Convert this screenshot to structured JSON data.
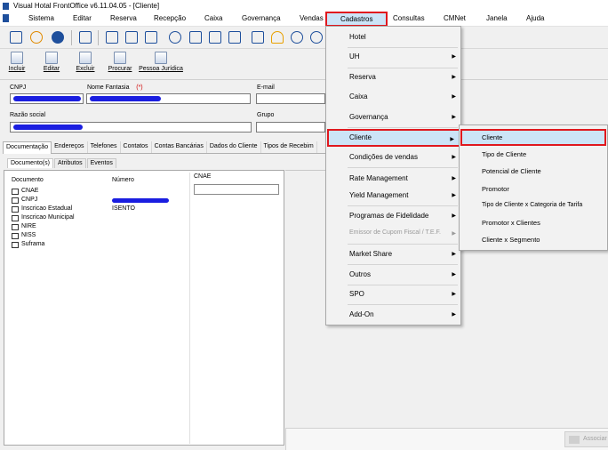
{
  "window": {
    "title": "Visual Hotal FrontOffice v6.11.04.05 - [Cliente]"
  },
  "menubar": {
    "items": [
      {
        "label": "Sistema"
      },
      {
        "label": "Editar"
      },
      {
        "label": "Reserva"
      },
      {
        "label": "Recepção"
      },
      {
        "label": "Caixa"
      },
      {
        "label": "Governança"
      },
      {
        "label": "Vendas"
      },
      {
        "label": "Cadastros",
        "active": true
      },
      {
        "label": "Consultas"
      },
      {
        "label": "CMNet"
      },
      {
        "label": "Janela"
      },
      {
        "label": "Ajuda"
      }
    ]
  },
  "toolbar": {
    "icons": [
      "door-exit-icon",
      "user-icon",
      "help-icon",
      "computer-icon",
      "mail-icon",
      "document-edit-icon",
      "mail-send-icon",
      "search-icon",
      "calendar-icon",
      "id-card-icon",
      "list-icon",
      "document-check-icon",
      "bell-icon",
      "users-icon",
      "person-icon"
    ]
  },
  "actions": {
    "incluir": "Incluir",
    "editar": "Editar",
    "excluir": "Excluir",
    "procurar": "Procurar",
    "pessoa_juridica": "Pessoa Jurídica"
  },
  "form": {
    "cnpj_label": "CNPJ",
    "nome_fantasia_label": "Nome Fantasia",
    "required_mark": "(*)",
    "email_label": "E-mail",
    "razao_social_label": "Razão social",
    "grupo_label": "Grupo"
  },
  "tabs": [
    {
      "label": "Documentação",
      "active": true
    },
    {
      "label": "Endereços"
    },
    {
      "label": "Telefones"
    },
    {
      "label": "Contatos"
    },
    {
      "label": "Contas Bancárias"
    },
    {
      "label": "Dados do Cliente"
    },
    {
      "label": "Tipos de Recebim"
    }
  ],
  "subtabs": [
    {
      "label": "Documento(s)",
      "active": true
    },
    {
      "label": "Atributos"
    },
    {
      "label": "Eventos"
    }
  ],
  "documents": {
    "col_documento": "Documento",
    "col_numero": "Número",
    "col_cnae": "CNAE",
    "items": [
      {
        "name": "CNAE",
        "number": ""
      },
      {
        "name": "CNPJ",
        "number": ""
      },
      {
        "name": "Inscricao Estadual",
        "number": "ISENTO"
      },
      {
        "name": "Inscricao Municipal",
        "number": ""
      },
      {
        "name": "NIRE",
        "number": ""
      },
      {
        "name": "NISS",
        "number": ""
      },
      {
        "name": "Suframa",
        "number": ""
      }
    ]
  },
  "status": {
    "associar_label": "Associar"
  },
  "cadastros_menu": {
    "items": [
      {
        "label": "Hotel",
        "submenu": false
      },
      {
        "label": "UH",
        "submenu": true
      },
      {
        "label": "Reserva",
        "submenu": true
      },
      {
        "label": "Caixa",
        "submenu": true
      },
      {
        "label": "Governança",
        "submenu": true
      },
      {
        "label": "Cliente",
        "submenu": true,
        "active": true
      },
      {
        "label": "Condições de vendas",
        "submenu": true
      },
      {
        "label": "Rate Management",
        "submenu": true
      },
      {
        "label": "Yield Management",
        "submenu": true
      },
      {
        "label": "Programas de Fidelidade",
        "submenu": true
      },
      {
        "label": "Emissor de Cupom Fiscal / T.E.F.",
        "submenu": true,
        "disabled": true
      },
      {
        "label": "Market Share",
        "submenu": true
      },
      {
        "label": "Outros",
        "submenu": true
      },
      {
        "label": "SPO",
        "submenu": true
      },
      {
        "label": "Add-On",
        "submenu": true
      }
    ]
  },
  "cliente_submenu": {
    "items": [
      {
        "label": "Cliente",
        "active": true
      },
      {
        "label": "Tipo de Cliente"
      },
      {
        "label": "Potencial de Cliente"
      },
      {
        "label": "Promotor"
      },
      {
        "label": "Tipo de Cliente x Categoria de Tarifa"
      },
      {
        "label": "Promotor x Clientes"
      },
      {
        "label": "Cliente x Segmento"
      }
    ]
  },
  "colors": {
    "accent_highlight": "#cce4f7",
    "annotation_red": "#e0181e",
    "redaction_blue": "#1a1ee0",
    "brand_blue": "#1e4f9c"
  }
}
